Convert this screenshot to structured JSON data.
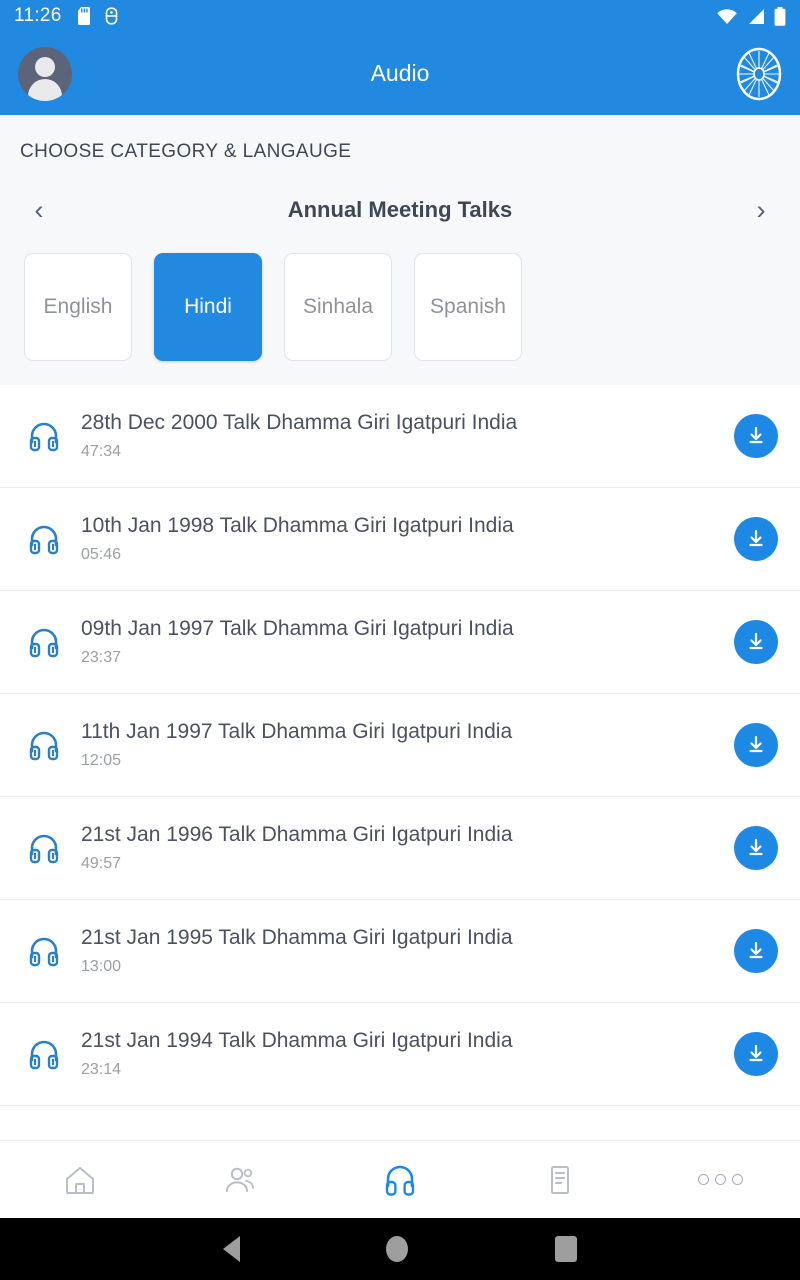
{
  "status_bar": {
    "time": "11:26",
    "left_icons": [
      "sd-card-icon",
      "usb-debug-icon"
    ],
    "right_icons": [
      "wifi-icon",
      "signal-icon",
      "battery-icon"
    ]
  },
  "app_bar": {
    "title": "Audio",
    "avatar": "user-avatar",
    "logo": "dhamma-wheel-icon"
  },
  "chooser": {
    "label": "CHOOSE CATEGORY & LANGAUGE",
    "prev_icon": "chevron-left-icon",
    "next_icon": "chevron-right-icon",
    "category": "Annual Meeting Talks",
    "languages": [
      {
        "label": "English",
        "selected": false
      },
      {
        "label": "Hindi",
        "selected": true
      },
      {
        "label": "Sinhala",
        "selected": false
      },
      {
        "label": "Spanish",
        "selected": false
      }
    ]
  },
  "tracks": [
    {
      "title": "28th Dec 2000 Talk Dhamma Giri Igatpuri India",
      "duration": "47:34"
    },
    {
      "title": "10th Jan 1998 Talk Dhamma Giri Igatpuri India",
      "duration": "05:46"
    },
    {
      "title": "09th Jan 1997 Talk Dhamma Giri Igatpuri India",
      "duration": "23:37"
    },
    {
      "title": "11th Jan 1997 Talk Dhamma Giri Igatpuri India",
      "duration": "12:05"
    },
    {
      "title": "21st Jan 1996 Talk Dhamma Giri Igatpuri India",
      "duration": "49:57"
    },
    {
      "title": "21st Jan 1995 Talk Dhamma Giri Igatpuri India",
      "duration": "13:00"
    },
    {
      "title": "21st Jan 1994 Talk Dhamma Giri Igatpuri India",
      "duration": "23:14"
    }
  ],
  "bottom_nav": [
    {
      "icon": "home-icon",
      "active": false
    },
    {
      "icon": "people-icon",
      "active": false
    },
    {
      "icon": "headphones-icon",
      "active": true
    },
    {
      "icon": "document-icon",
      "active": false
    },
    {
      "icon": "more-icon",
      "active": false
    }
  ],
  "system_nav": {
    "back": "back-triangle-icon",
    "home": "home-circle-icon",
    "recents": "recents-square-icon"
  },
  "colors": {
    "primary": "#2189E0",
    "accent": "#1E88E5",
    "section_bg": "#F7F8F9",
    "title_text": "#4a5160",
    "muted_text": "#9aa0a8"
  }
}
